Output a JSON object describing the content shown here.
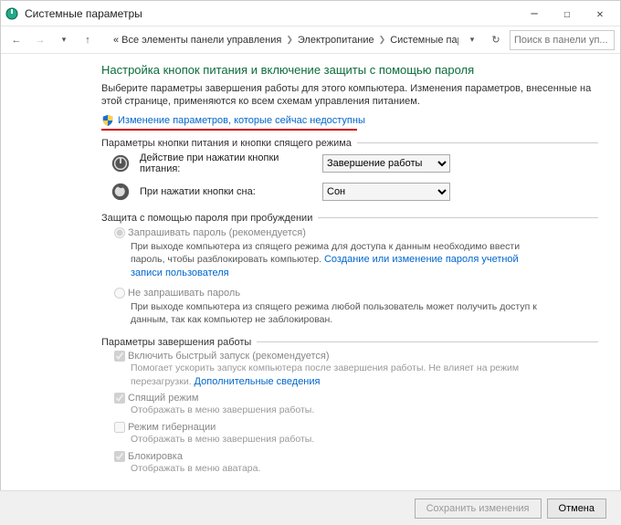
{
  "window": {
    "title": "Системные параметры"
  },
  "nav": {
    "breadcrumb": {
      "level1": "Все элементы панели управления",
      "level2": "Электропитание",
      "level3": "Системные параметры"
    },
    "search_placeholder": "Поиск в панели уп..."
  },
  "heading": "Настройка кнопок питания и включение защиты с помощью пароля",
  "intro": "Выберите параметры завершения работы для этого компьютера. Изменения параметров, внесенные на этой странице, применяются ко всем схемам управления питанием.",
  "change_link": "Изменение параметров, которые сейчас недоступны",
  "section_buttons": {
    "title": "Параметры кнопки питания и кнопки спящего режима",
    "power_label": "Действие при нажатии кнопки питания:",
    "power_value": "Завершение работы",
    "sleep_label": "При нажатии кнопки сна:",
    "sleep_value": "Сон"
  },
  "section_password": {
    "title": "Защита с помощью пароля при пробуждении",
    "opt1_label": "Запрашивать пароль (рекомендуется)",
    "opt1_sub_a": "При выходе компьютера из спящего режима для доступа к данным необходимо ввести пароль, чтобы разблокировать компьютер. ",
    "opt1_link": "Создание или изменение пароля учетной записи пользователя",
    "opt2_label": "Не запрашивать пароль",
    "opt2_sub": "При выходе компьютера из спящего режима любой пользователь может получить доступ к данным, так как компьютер не заблокирован."
  },
  "section_shutdown": {
    "title": "Параметры завершения работы",
    "chk1_label": "Включить быстрый запуск (рекомендуется)",
    "chk1_sub_a": "Помогает ускорить запуск компьютера после завершения работы. Не влияет на режим перезагрузки. ",
    "chk1_link": "Дополнительные сведения",
    "chk2_label": "Спящий режим",
    "chk2_sub": "Отображать в меню завершения работы.",
    "chk3_label": "Режим гибернации",
    "chk3_sub": "Отображать в меню завершения работы.",
    "chk4_label": "Блокировка",
    "chk4_sub": "Отображать в меню аватара."
  },
  "buttons": {
    "save": "Сохранить изменения",
    "cancel": "Отмена"
  }
}
